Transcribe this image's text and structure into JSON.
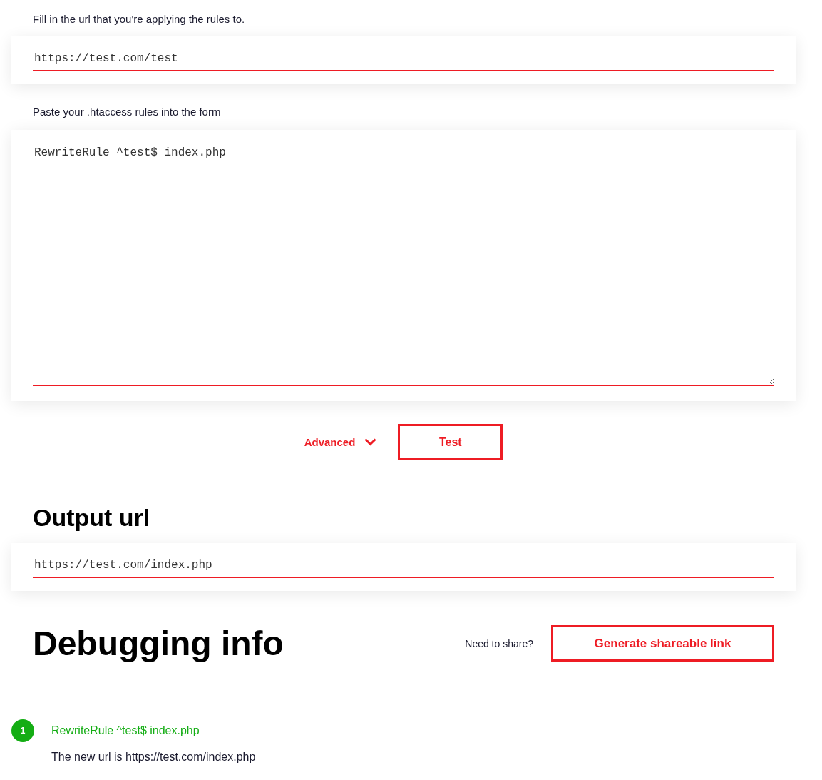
{
  "url_section": {
    "label": "Fill in the url that you're applying the rules to.",
    "value": "https://test.com/test"
  },
  "rules_section": {
    "label": "Paste your .htaccess rules into the form",
    "value": "RewriteRule ^test$ index.php"
  },
  "actions": {
    "advanced": {
      "label": "Advanced",
      "expanded": false
    },
    "test_button": "Test"
  },
  "output": {
    "heading": "Output url",
    "value": "https://test.com/index.php"
  },
  "debugging": {
    "heading": "Debugging info",
    "share_prompt": "Need to share?",
    "share_button": "Generate shareable link",
    "steps": [
      {
        "number": "1",
        "rule": "RewriteRule ^test$ index.php",
        "message": "The new url is https://test.com/index.php",
        "color": "#14ad14"
      }
    ]
  }
}
